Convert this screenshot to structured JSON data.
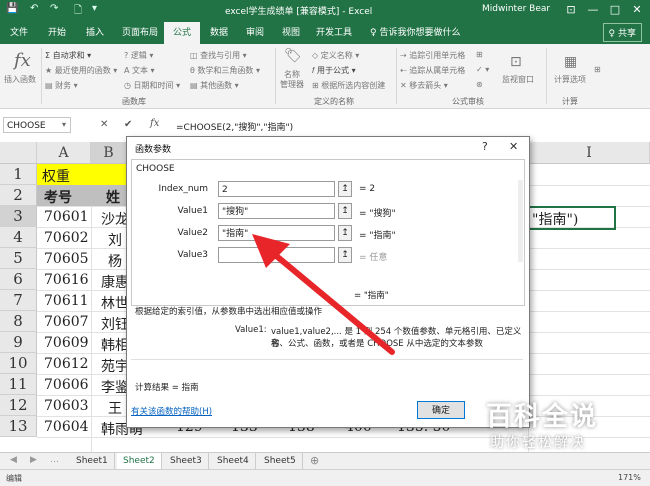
{
  "window": {
    "title": "excel学生成绩单 [兼容模式] - Excel",
    "user": "Midwinter Bear",
    "quick_access": [
      "💾",
      "↶",
      "↷",
      "🗋",
      "▾"
    ],
    "controls": [
      "⊡",
      "—",
      "□",
      "✕"
    ]
  },
  "ribbon_tabs": [
    "文件",
    "开始",
    "插入",
    "页面布局",
    "公式",
    "数据",
    "审阅",
    "视图",
    "开发工具",
    "♀ 告诉我你想要做什么"
  ],
  "share_label": "♀ 共享",
  "ribbon": {
    "insert_function": {
      "icon": "fx",
      "label": "插入函数"
    },
    "lib_col1": [
      "Σ 自动求和 ▾",
      "★ 最近使用的函数 ▾",
      "▤ 财务 ▾"
    ],
    "lib_col2": [
      "? 逻辑 ▾",
      "A 文本 ▾",
      "◷ 日期和时间 ▾"
    ],
    "lib_col3": [
      "◫ 查找与引用 ▾",
      "θ 数学和三角函数 ▾",
      "▤ 其他函数 ▾"
    ],
    "lib_group": "函数库",
    "name_manager": {
      "icon": "🏷",
      "label": "名称\n管理器"
    },
    "names_col": [
      "◇ 定义名称 ▾",
      "𝑓 用于公式 ▾",
      "⊞ 根据所选内容创建"
    ],
    "names_group": "定义的名称",
    "audit_col1": [
      "⇢ 追踪引用单元格",
      "⇠ 追踪从属单元格",
      "✕ 移去箭头 ▾"
    ],
    "audit_col2": [
      "⊞",
      "✓ ▾",
      "⊛"
    ],
    "watch_window": "监视窗口",
    "audit_group": "公式审核",
    "calc_options": "计算选项",
    "calc_group": "计算"
  },
  "formula_bar": {
    "name_box": "CHOOSE",
    "cancel": "✕",
    "enter": "✔",
    "fx": "fx",
    "formula": "=CHOOSE(2,\"搜狗\",\"指南\")"
  },
  "grid": {
    "columns": [
      "A",
      "B",
      "I"
    ],
    "rows": [
      "1",
      "2",
      "3",
      "4",
      "5",
      "6",
      "7",
      "8",
      "9",
      "10",
      "11",
      "12",
      "13"
    ],
    "cells": {
      "r1": [
        "权重"
      ],
      "r2": [
        "考号",
        "姓"
      ],
      "col_a": [
        "70601",
        "70602",
        "70605",
        "70616",
        "70611",
        "70607",
        "70609",
        "70612",
        "70606",
        "70603",
        "70604"
      ],
      "col_b": [
        "沙龙",
        "刘",
        "杨",
        "康惠",
        "林世",
        "刘钰",
        "韩相",
        "苑宇",
        "李鉴",
        "王",
        "韩雨萌"
      ],
      "i3_preview": "\"指南\")",
      "r13_rest": [
        "129",
        "133",
        "138",
        "400",
        "135. 50"
      ]
    }
  },
  "sheet_tabs": [
    "Sheet1",
    "Sheet2",
    "Sheet3",
    "Sheet4",
    "Sheet5"
  ],
  "active_sheet": "Sheet2",
  "status": {
    "mode": "编辑",
    "zoom": "171%"
  },
  "dialog": {
    "title": "函数参数",
    "help": "?",
    "close": "✕",
    "function_name": "CHOOSE",
    "args": [
      {
        "label": "Index_num",
        "value": "2",
        "result": "=  2"
      },
      {
        "label": "Value1",
        "value": "\"搜狗\"",
        "result": "=  \"搜狗\""
      },
      {
        "label": "Value2",
        "value": "\"指南\"",
        "result": "=  \"指南\""
      },
      {
        "label": "Value3",
        "value": "",
        "result": "=  任意"
      }
    ],
    "ref_button": "↥",
    "overall_result": "=  \"指南\"",
    "description": "根据给定的索引值，从参数串中选出相应值或操作",
    "arg_help_label": "Value1:",
    "arg_help_text1": "value1,value2,... 是 1 到 254 个数值参数、单元格引用、已定义名",
    "arg_help_text2": "称、公式、函数，或者是 CHOOSE 从中选定的文本参数",
    "calc_result": "计算结果 =   指南",
    "help_link": "有关该函数的帮助(H)",
    "ok": "确定"
  },
  "watermark": {
    "line1": "百科全说",
    "line2": "助你轻松解决"
  },
  "colors": {
    "excel_green": "#217346",
    "arrow_red": "#e8262a",
    "header_yellow": "#ffff00",
    "selection_green": "#217346"
  }
}
